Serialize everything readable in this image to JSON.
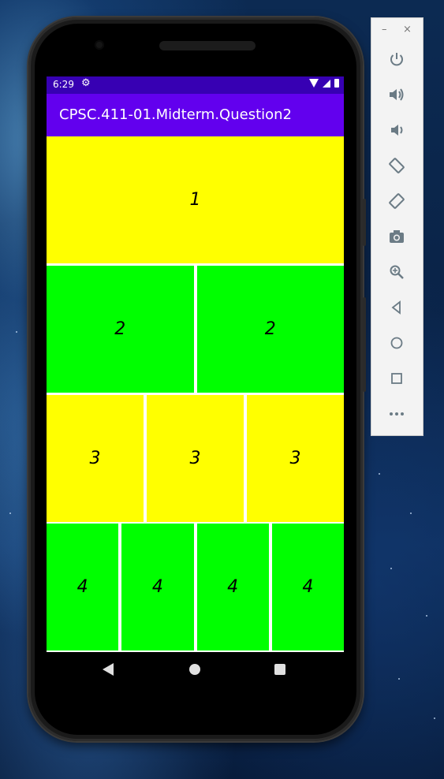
{
  "statusbar": {
    "time": "6:29"
  },
  "appbar": {
    "title": "CPSC.411-01.Midterm.Question2"
  },
  "grid": {
    "row1": [
      "1"
    ],
    "row2": [
      "2",
      "2"
    ],
    "row3": [
      "3",
      "3",
      "3"
    ],
    "row4": [
      "4",
      "4",
      "4",
      "4"
    ]
  },
  "colors": {
    "status_bar": "#3700b3",
    "app_bar": "#6200ee",
    "yellow_cell": "#ffff00",
    "green_cell": "#00ff00"
  },
  "toolbar": {
    "minimize": "–",
    "close": "×",
    "buttons": [
      "power-icon",
      "volume-up-icon",
      "volume-down-icon",
      "rotate-left-icon",
      "rotate-right-icon",
      "camera-icon",
      "zoom-icon",
      "back-icon",
      "home-icon",
      "overview-icon",
      "more-icon"
    ]
  }
}
